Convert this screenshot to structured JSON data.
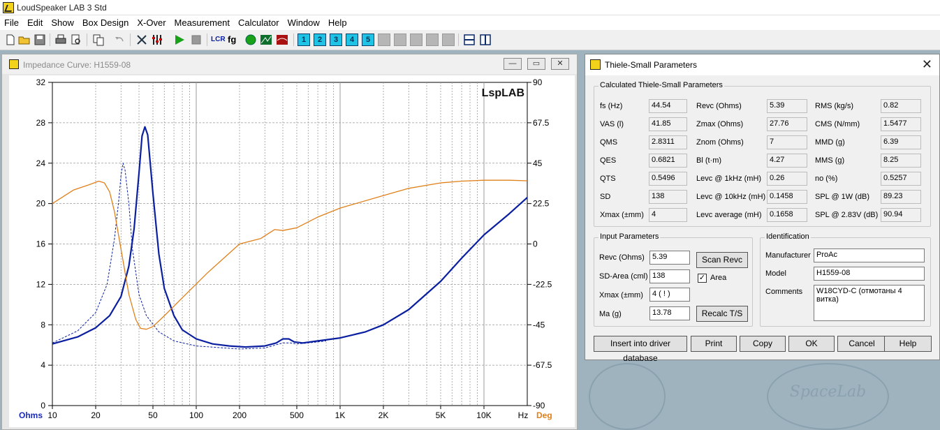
{
  "app": {
    "title": "LoudSpeaker LAB 3 Std",
    "menu": [
      "File",
      "Edit",
      "Show",
      "Box Design",
      "X-Over",
      "Measurement",
      "Calculator",
      "Window",
      "Help"
    ],
    "toolbar_numbers": [
      "1",
      "2",
      "3",
      "4",
      "5"
    ],
    "toolbar_text_icons": {
      "lcr": "LCR",
      "fg": "fg"
    }
  },
  "impedance_window": {
    "title": "Impedance Curve: H1559-08",
    "watermark": "LspLAB",
    "units_left": "Ohms",
    "units_right": "Deg",
    "x_unit": "Hz"
  },
  "chart_data": {
    "type": "line",
    "x_scale": "log",
    "x_range": [
      10,
      20000
    ],
    "x_ticks": [
      "10",
      "20",
      "50",
      "100",
      "200",
      "500",
      "1K",
      "2K",
      "5K",
      "10K"
    ],
    "x_tick_values": [
      10,
      20,
      50,
      100,
      200,
      500,
      1000,
      2000,
      5000,
      10000
    ],
    "y_left": {
      "label": "Ohms",
      "range": [
        0,
        32
      ],
      "ticks": [
        "0",
        "4",
        "8",
        "12",
        "16",
        "20",
        "24",
        "28",
        "32"
      ]
    },
    "y_right": {
      "label": "Deg",
      "range": [
        -90,
        90
      ],
      "ticks": [
        "-90",
        "-67.5",
        "-45",
        "-22.5",
        "0",
        "22.5",
        "45",
        "67.5",
        "90"
      ]
    },
    "colors": {
      "impedance": "#0a1fa0",
      "phase": "#e0801a",
      "grid": "#9a9a9a"
    },
    "series": [
      {
        "style": "solid",
        "color": "#0a1fa0",
        "axis": "left",
        "points": [
          [
            10,
            6.1
          ],
          [
            15,
            6.8
          ],
          [
            20,
            7.7
          ],
          [
            25,
            8.9
          ],
          [
            30,
            10.8
          ],
          [
            34,
            13.8
          ],
          [
            37,
            17.5
          ],
          [
            40,
            23
          ],
          [
            42,
            26.7
          ],
          [
            44,
            27.6
          ],
          [
            46,
            26.8
          ],
          [
            50,
            21
          ],
          [
            55,
            15
          ],
          [
            60,
            11.6
          ],
          [
            70,
            8.9
          ],
          [
            80,
            7.5
          ],
          [
            100,
            6.6
          ],
          [
            130,
            6.1
          ],
          [
            170,
            5.9
          ],
          [
            220,
            5.8
          ],
          [
            300,
            5.9
          ],
          [
            360,
            6.2
          ],
          [
            400,
            6.6
          ],
          [
            440,
            6.6
          ],
          [
            480,
            6.3
          ],
          [
            550,
            6.2
          ],
          [
            700,
            6.4
          ],
          [
            1000,
            6.7
          ],
          [
            1500,
            7.3
          ],
          [
            2000,
            8.0
          ],
          [
            3000,
            9.5
          ],
          [
            5000,
            12.3
          ],
          [
            7000,
            14.6
          ],
          [
            10000,
            16.9
          ],
          [
            15000,
            19.0
          ],
          [
            20000,
            20.6
          ]
        ]
      },
      {
        "style": "dashed",
        "color": "#0a1fa0",
        "axis": "left",
        "points": [
          [
            10,
            6.2
          ],
          [
            15,
            7.4
          ],
          [
            20,
            9.2
          ],
          [
            24,
            12
          ],
          [
            27,
            16.5
          ],
          [
            29,
            20.5
          ],
          [
            30,
            22.8
          ],
          [
            31,
            24
          ],
          [
            32,
            23.3
          ],
          [
            34,
            20
          ],
          [
            36,
            15.5
          ],
          [
            40,
            11
          ],
          [
            45,
            8.9
          ],
          [
            55,
            7.3
          ],
          [
            70,
            6.4
          ],
          [
            100,
            5.9
          ],
          [
            200,
            5.6
          ],
          [
            300,
            5.7
          ],
          [
            400,
            6.2
          ],
          [
            450,
            6.2
          ],
          [
            500,
            6.1
          ],
          [
            600,
            6.2
          ],
          [
            800,
            6.4
          ]
        ]
      },
      {
        "style": "solid",
        "color": "#e0801a",
        "axis": "right",
        "points": [
          [
            10,
            22.5
          ],
          [
            14,
            30
          ],
          [
            18,
            33
          ],
          [
            21,
            35
          ],
          [
            23,
            34
          ],
          [
            25,
            29
          ],
          [
            27,
            18
          ],
          [
            30,
            -3
          ],
          [
            34,
            -28
          ],
          [
            38,
            -42
          ],
          [
            41,
            -47
          ],
          [
            45,
            -47.5
          ],
          [
            50,
            -46
          ],
          [
            60,
            -40
          ],
          [
            80,
            -30
          ],
          [
            120,
            -16
          ],
          [
            200,
            0
          ],
          [
            280,
            3
          ],
          [
            350,
            8
          ],
          [
            400,
            7.5
          ],
          [
            500,
            9
          ],
          [
            700,
            15
          ],
          [
            1000,
            20
          ],
          [
            2000,
            27
          ],
          [
            3000,
            31
          ],
          [
            5000,
            34
          ],
          [
            7000,
            35
          ],
          [
            10000,
            35.5
          ],
          [
            15000,
            35.5
          ],
          [
            20000,
            35.2
          ]
        ]
      }
    ]
  },
  "ts_dialog": {
    "title": "Thiele-Small Parameters",
    "calc_group": "Calculated Thiele-Small Parameters",
    "calc_rows": [
      [
        [
          "fs (Hz)",
          "44.54"
        ],
        [
          "Revc (Ohms)",
          "5.39"
        ],
        [
          "RMS (kg/s)",
          "0.82"
        ]
      ],
      [
        [
          "VAS (l)",
          "41.85"
        ],
        [
          "Zmax (Ohms)",
          "27.76"
        ],
        [
          "CMS (N/mm)",
          "1.5477"
        ]
      ],
      [
        [
          "QMS",
          "2.8311"
        ],
        [
          "Znom (Ohms)",
          "7"
        ],
        [
          "MMD (g)",
          "6.39"
        ]
      ],
      [
        [
          "QES",
          "0.6821"
        ],
        [
          "Bl (t·m)",
          "4.27"
        ],
        [
          "MMS (g)",
          "8.25"
        ]
      ],
      [
        [
          "QTS",
          "0.5496"
        ],
        [
          "Levc @ 1kHz (mH)",
          "0.26"
        ],
        [
          "no (%)",
          "0.5257"
        ]
      ],
      [
        [
          "SD",
          "138"
        ],
        [
          "Levc @ 10kHz (mH)",
          "0.1458"
        ],
        [
          "SPL @ 1W (dB)",
          "89.23"
        ]
      ],
      [
        [
          "Xmax (±mm)",
          "4"
        ],
        [
          "Levc average (mH)",
          "0.1658"
        ],
        [
          "SPL @ 2.83V (dB)",
          "90.94"
        ]
      ]
    ],
    "input_group": "Input Parameters",
    "inputs": [
      [
        "Revc (Ohms)",
        "5.39"
      ],
      [
        "SD-Area (cml)",
        "138"
      ],
      [
        "Xmax (±mm)",
        "4 ( ! )"
      ],
      [
        "Ma (g)",
        "13.78"
      ]
    ],
    "scan_revc": "Scan Revc",
    "area_label": "Area",
    "area_checked": true,
    "recalc": "Recalc T/S",
    "ident_group": "Identification",
    "manufacturer_label": "Manufacturer",
    "manufacturer": "ProAc",
    "model_label": "Model",
    "model": "H1559-08",
    "comments_label": "Comments",
    "comments": "W18CYD-C (отмотаны 4 витка)",
    "buttons": [
      "Insert into driver database",
      "Print",
      "Copy",
      "OK",
      "Cancel",
      "Help"
    ]
  },
  "background_logo": "SpaceLab"
}
